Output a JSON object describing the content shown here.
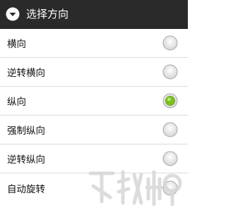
{
  "dialog": {
    "title": "选择方向",
    "title_icon": "chevron-down-circle-icon",
    "options": [
      {
        "label": "横向",
        "selected": false
      },
      {
        "label": "逆转横向",
        "selected": false
      },
      {
        "label": "纵向",
        "selected": true
      },
      {
        "label": "强制纵向",
        "selected": false
      },
      {
        "label": "逆转纵向",
        "selected": false
      },
      {
        "label": "自动旋转",
        "selected": false
      }
    ]
  },
  "colors": {
    "titlebar_bg": "#2a2a2a",
    "title_text": "#ffffff",
    "radio_selected": "#7cc11b",
    "divider": "#dcdcdc"
  }
}
